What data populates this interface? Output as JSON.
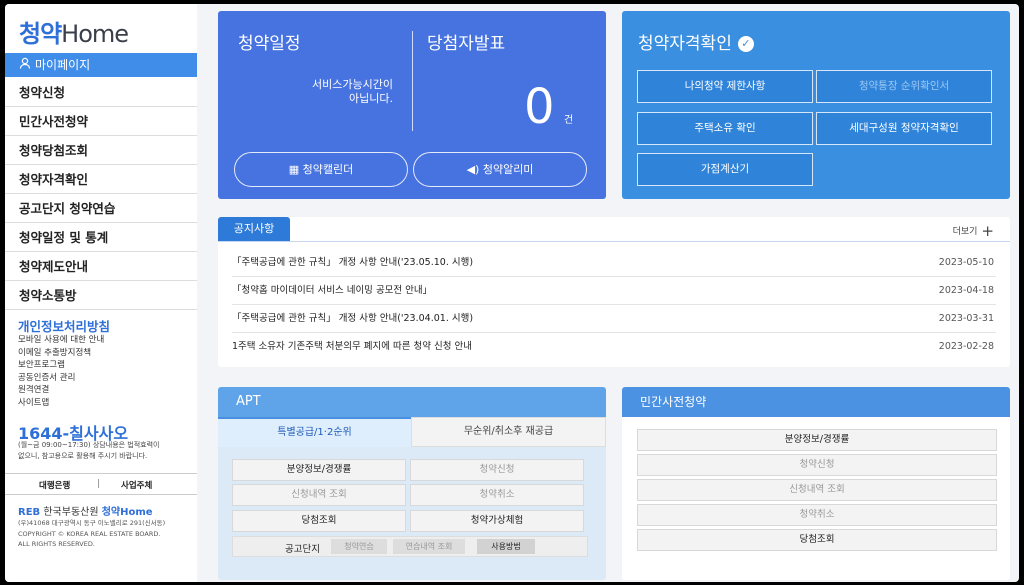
{
  "brand": {
    "logo_ko": "청약",
    "logo_en": "Home"
  },
  "sidebar": {
    "mypage": "마이페이지",
    "items": [
      "청약신청",
      "민간사전청약",
      "청약당첨조회",
      "청약자격확인",
      "공고단지 청약연습",
      "청약일정 및 통계",
      "청약제도안내",
      "청약소통방"
    ],
    "privacy": "개인정보처리방침",
    "links": [
      "모바일 사용에 대한 안내",
      "이메일 추출방지정책",
      "보안프로그램",
      "공동인증서 관리",
      "원격연결",
      "사이트맵"
    ],
    "phone": "1644-칠사사오",
    "hours_line1": "(월~금 09:00~17:30) 상담내용은 법적효력이",
    "hours_line2": "없으니, 참고용으로 활용해 주시기 바랍니다.",
    "bank": "대행은행",
    "sep": "|",
    "biz": "사업주체",
    "reb_name": "한국부동산원",
    "reb_prefix": "REB",
    "reb_brand": "청약Home",
    "addr1": "(우)41068 대구광역시 동구 이노밸리로 291(신서동)",
    "addr2": "COPYRIGHT © KOREA REAL ESTATE BOARD.",
    "addr3": "ALL RIGHTS RESERVED."
  },
  "schedule": {
    "title": "청약일정",
    "notice_title": "당첨자발표",
    "service_line1": "서비스가능시간이",
    "service_line2": "아닙니다.",
    "count": "0",
    "unit": "건",
    "calendar_btn": "청약캘린더",
    "alarm_btn": "청약알리미"
  },
  "qualification": {
    "title": "청약자격확인",
    "buttons": [
      "나의청약 제한사항",
      "청약통장 순위확인서",
      "주택소유 확인",
      "세대구성원 청약자격확인",
      "가점계산기"
    ]
  },
  "notice": {
    "tab": "공지사항",
    "more": "더보기",
    "rows": [
      {
        "title": "「주택공급에 관한 규칙」 개정 사항 안내('23.05.10. 시행)",
        "date": "2023-05-10"
      },
      {
        "title": "「청약홈 마이데이터 서비스 네이밍 공모전 안내」",
        "date": "2023-04-18"
      },
      {
        "title": "「주택공급에 관한 규칙」 개정 사항 안내('23.04.01. 시행)",
        "date": "2023-03-31"
      },
      {
        "title": "1주택 소유자 기존주택 처분의무 폐지에 따른 청약 신청 안내",
        "date": "2023-02-28"
      }
    ]
  },
  "apt": {
    "title": "APT",
    "tab1": "특별공급/1·2순위",
    "tab2": "무순위/취소후 재공급",
    "buttons": [
      "분양정보/경쟁률",
      "청약신청",
      "신청내역 조회",
      "청약취소",
      "당첨조회",
      "청약가상체험"
    ],
    "gongo_label": "공고단지",
    "chips": [
      "청약연습",
      "연습내역 조회",
      "사용방법"
    ]
  },
  "private_pre": {
    "title": "민간사전청약",
    "buttons": [
      "분양정보/경쟁률",
      "청약신청",
      "신청내역 조회",
      "청약취소",
      "당첨조회"
    ]
  }
}
